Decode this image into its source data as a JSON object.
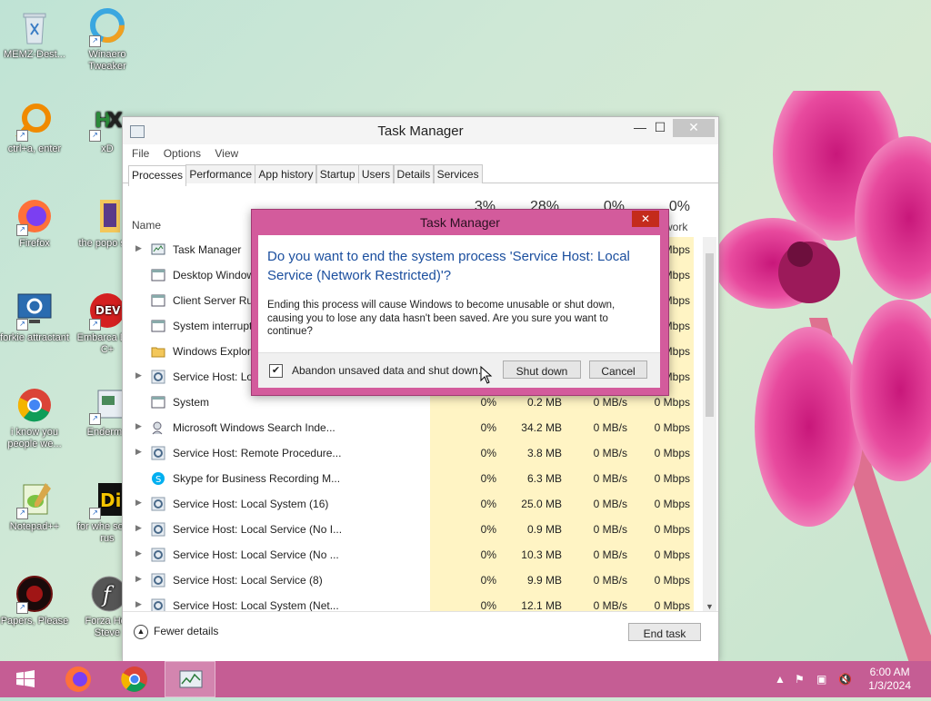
{
  "desktop": {
    "icons": [
      {
        "label": "MEMZ-Dest..."
      },
      {
        "label": "Winaero Tweaker"
      },
      {
        "label": "ctrl+a, enter"
      },
      {
        "label": "xD"
      },
      {
        "label": "Firefox"
      },
      {
        "label": "the popo shit"
      },
      {
        "label": "forkie attractant"
      },
      {
        "label": "Embarca Dev C+"
      },
      {
        "label": "i know you people we..."
      },
      {
        "label": "Enderma"
      },
      {
        "label": "Notepad++"
      },
      {
        "label": "for whe some rus"
      },
      {
        "label": "Papers, Please"
      },
      {
        "label": "Forza Hor Steve"
      }
    ]
  },
  "task_manager": {
    "title": "Task Manager",
    "menu": [
      "File",
      "Options",
      "View"
    ],
    "tabs": [
      "Processes",
      "Performance",
      "App history",
      "Startup",
      "Users",
      "Details",
      "Services"
    ],
    "active_tab": "Processes",
    "columns": {
      "name": "Name",
      "cpu_pct": "3%",
      "mem_pct": "28%",
      "disk_pct": "0%",
      "net_pct": "0%",
      "net_label": "work"
    },
    "rows": [
      {
        "name": "Task Manager",
        "cpu": "",
        "mem": "",
        "disk": "",
        "net": "Mbps",
        "expand": true,
        "icon": "taskmgr-icon"
      },
      {
        "name": "Desktop Window",
        "cpu": "",
        "mem": "",
        "disk": "",
        "net": "Mbps",
        "expand": false,
        "icon": "window-icon"
      },
      {
        "name": "Client Server Ru",
        "cpu": "",
        "mem": "",
        "disk": "",
        "net": "Mbps",
        "expand": false,
        "icon": "window-icon"
      },
      {
        "name": "System interrupt",
        "cpu": "",
        "mem": "",
        "disk": "",
        "net": "Mbps",
        "expand": false,
        "icon": "window-icon"
      },
      {
        "name": "Windows Explore",
        "cpu": "",
        "mem": "",
        "disk": "",
        "net": "Mbps",
        "expand": false,
        "icon": "folder-icon"
      },
      {
        "name": "Service Host: Lo",
        "cpu": "",
        "mem": "",
        "disk": "",
        "net": "Mbps",
        "expand": true,
        "icon": "gear-icon"
      },
      {
        "name": "System",
        "cpu": "0%",
        "mem": "0.2 MB",
        "disk": "0 MB/s",
        "net": "0 Mbps",
        "expand": false,
        "icon": "window-icon"
      },
      {
        "name": "Microsoft Windows Search Inde...",
        "cpu": "0%",
        "mem": "34.2 MB",
        "disk": "0 MB/s",
        "net": "0 Mbps",
        "expand": true,
        "icon": "search-person-icon"
      },
      {
        "name": "Service Host: Remote Procedure...",
        "cpu": "0%",
        "mem": "3.8 MB",
        "disk": "0 MB/s",
        "net": "0 Mbps",
        "expand": true,
        "icon": "gear-icon"
      },
      {
        "name": "Skype for Business Recording M...",
        "cpu": "0%",
        "mem": "6.3 MB",
        "disk": "0 MB/s",
        "net": "0 Mbps",
        "expand": false,
        "icon": "skype-icon"
      },
      {
        "name": "Service Host: Local System (16)",
        "cpu": "0%",
        "mem": "25.0 MB",
        "disk": "0 MB/s",
        "net": "0 Mbps",
        "expand": true,
        "icon": "gear-icon"
      },
      {
        "name": "Service Host: Local Service (No I...",
        "cpu": "0%",
        "mem": "0.9 MB",
        "disk": "0 MB/s",
        "net": "0 Mbps",
        "expand": true,
        "icon": "gear-icon"
      },
      {
        "name": "Service Host: Local Service (No ...",
        "cpu": "0%",
        "mem": "10.3 MB",
        "disk": "0 MB/s",
        "net": "0 Mbps",
        "expand": true,
        "icon": "gear-icon"
      },
      {
        "name": "Service Host: Local Service (8)",
        "cpu": "0%",
        "mem": "9.9 MB",
        "disk": "0 MB/s",
        "net": "0 Mbps",
        "expand": true,
        "icon": "gear-icon"
      },
      {
        "name": "Service Host: Local System (Net...",
        "cpu": "0%",
        "mem": "12.1 MB",
        "disk": "0 MB/s",
        "net": "0 Mbps",
        "expand": true,
        "icon": "gear-icon"
      }
    ],
    "fewer_details": "Fewer details",
    "end_task": "End task"
  },
  "dialog": {
    "title": "Task Manager",
    "close": "✕",
    "question": "Do you want to end the system process 'Service Host: Local Service (Network Restricted)'?",
    "message": "Ending this process will cause Windows to become unusable or shut down, causing you to lose any data hasn't been saved. Are you sure you want to continue?",
    "checkbox_label": "Abandon unsaved data and shut down.",
    "checkbox_checked": true,
    "shutdown_button": "Shut down",
    "cancel_button": "Cancel"
  },
  "taskbar": {
    "time": "6:00 AM",
    "date": "1/3/2024",
    "color": "#c55d94"
  }
}
